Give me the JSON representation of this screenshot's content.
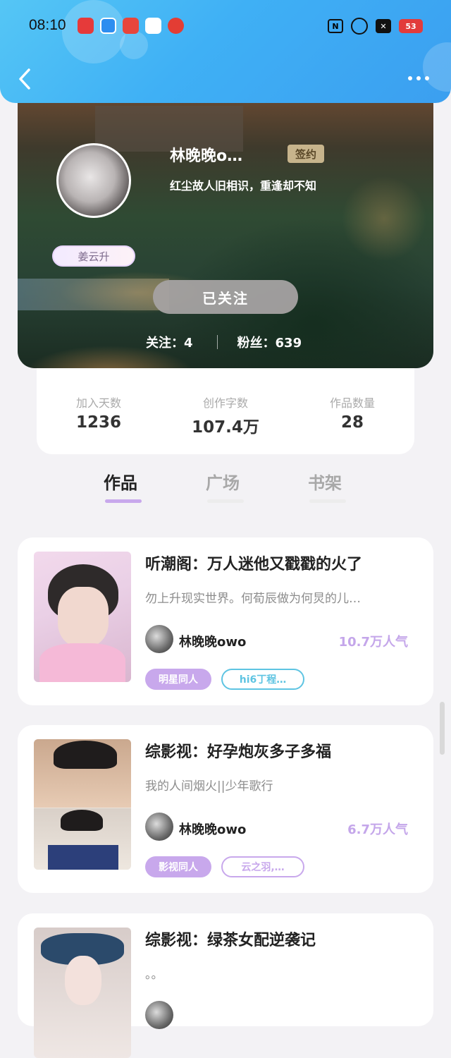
{
  "status_bar": {
    "time": "08:10",
    "battery": "53"
  },
  "profile": {
    "name": "林晚晚o…",
    "badge": "签约",
    "motto": "红尘故人旧相识，重逢却不知",
    "tag": "姜云升",
    "follow_button": "已关注",
    "following_label": "关注：4",
    "fans_label": "粉丝：639"
  },
  "stats": [
    {
      "label": "加入天数",
      "value": "1236"
    },
    {
      "label": "创作字数",
      "value": "107.4万"
    },
    {
      "label": "作品数量",
      "value": "28"
    }
  ],
  "tabs": [
    {
      "label": "作品",
      "active": true
    },
    {
      "label": "广场",
      "active": false
    },
    {
      "label": "书架",
      "active": false
    }
  ],
  "works": [
    {
      "title": "听潮阁：万人迷他又戳戳的火了",
      "desc": "勿上升现实世界。何荀辰做为何炅的儿…",
      "author": "林晚晚owo",
      "popularity": "10.7万人气",
      "tag_main": "明星同人",
      "tag_sub": "hi6丁程…",
      "tag_sub_color": "#5ec4e2"
    },
    {
      "title": "综影视：好孕炮灰多子多福",
      "desc": "我的人间烟火||少年歌行",
      "author": "林晚晚owo",
      "popularity": "6.7万人气",
      "tag_main": "影视同人",
      "tag_sub": "云之羽,…",
      "tag_sub_color": "#c8a8ec"
    },
    {
      "title": "综影视：绿茶女配逆袭记",
      "desc": "。。"
    }
  ],
  "colors": {
    "accent_purple": "#c8a8ec",
    "tab_active": "#222222",
    "tab_inactive": "#a8a8a8",
    "topbar_blue": "#3fb0f5"
  }
}
